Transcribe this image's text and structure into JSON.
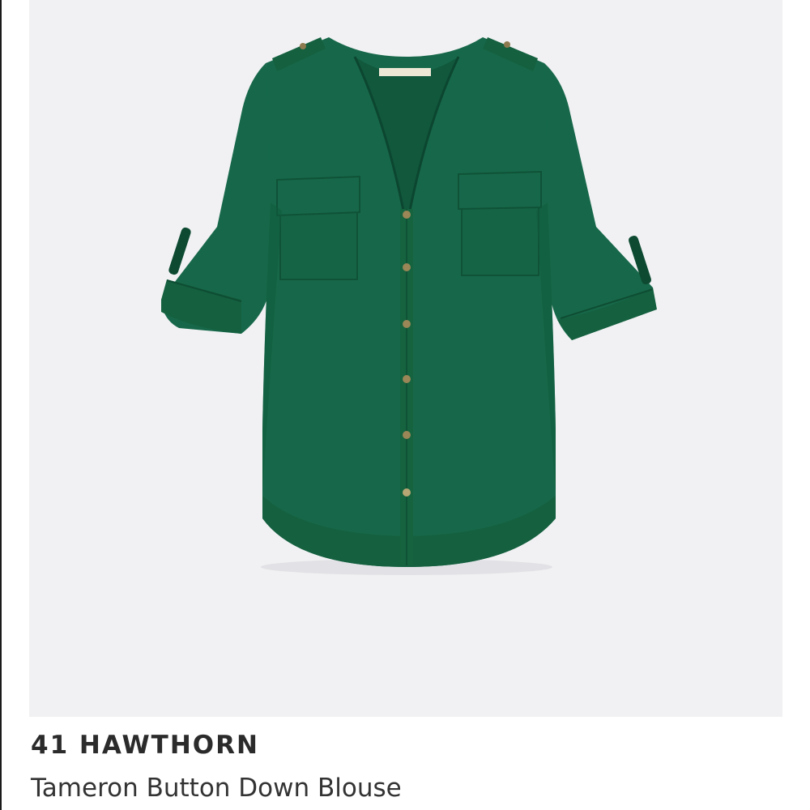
{
  "product": {
    "brand": "41 HAWTHORN",
    "name": "Tameron Button Down Blouse",
    "garment_color": "#17684a",
    "background_color": "#f1f1f3"
  }
}
